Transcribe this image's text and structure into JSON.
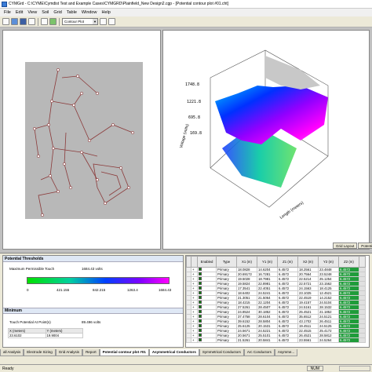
{
  "window": {
    "title": "CYMGrd - C:\\CYME\\Cymdist Test and Example Cases\\CYMGRD\\Plainfield_New Design2.cgp - [Potential contour plot #01.cht]"
  },
  "menu": [
    "File",
    "Edit",
    "View",
    "Soil",
    "Grid",
    "Table",
    "Window",
    "Help"
  ],
  "toolbar": {
    "view_select": "Contour Plot"
  },
  "chart3d": {
    "zticks": [
      "1748.8",
      "1221.8",
      "695.8",
      "169.8"
    ],
    "axis_x": "Length (meters)",
    "axis_z": "Voltage (volts)"
  },
  "right_tabs": [
    "Grid Layout",
    "Potential co..."
  ],
  "potential": {
    "header": "Potential Thresholds",
    "permissible_label": "Maximum Permissible Touch",
    "permissible_value": "1684.43 volts",
    "scale": [
      "0",
      "421.155",
      "842.215",
      "1263.4",
      "1684.43"
    ],
    "minimum_header": "Minimum",
    "touch_label": "Touch Potential At Point(s)",
    "touch_value": "89.496 volts",
    "col_x": "X (meters)",
    "col_y": "Y (meters)",
    "point": {
      "x": "23.6102",
      "y": "19.9004"
    }
  },
  "grid": {
    "headers": [
      "Enabled",
      "Type",
      "X1 (m)",
      "Y1 (m)",
      "Z1 (m)",
      "X2 (m)",
      "Y2 (m)",
      "Z2 (m)"
    ],
    "rows": [
      [
        "Primary",
        "18.0828",
        "14.6204",
        "6.4572",
        "18.2561",
        "23.4848",
        "6.4572"
      ],
      [
        "Primary",
        "20.69172",
        "16.7281",
        "6.4572",
        "20.7564",
        "23.5248",
        "6.4572"
      ],
      [
        "Primary",
        "19.5028",
        "18.7981",
        "6.4572",
        "22.5214",
        "25.1254",
        "6.4572"
      ],
      [
        "Primary",
        "19.5824",
        "22.8981",
        "6.4572",
        "22.5721",
        "23.1562",
        "6.4572"
      ],
      [
        "Primary",
        "17.3541",
        "22.4051",
        "6.4572",
        "24.1563",
        "18.4125",
        "6.4572"
      ],
      [
        "Primary",
        "18.6402",
        "24.5241",
        "6.4572",
        "23.1025",
        "12.4521",
        "6.4572"
      ],
      [
        "Primary",
        "21.3051",
        "21.5064",
        "6.4572",
        "22.4519",
        "14.2152",
        "6.4572"
      ],
      [
        "Primary",
        "18.4215",
        "22.1204",
        "6.4572",
        "19.4157",
        "24.5104",
        "6.4572"
      ],
      [
        "Primary",
        "27.5261",
        "28.4507",
        "6.4572",
        "24.5161",
        "28.1532",
        "6.4572"
      ],
      [
        "Primary",
        "24.8524",
        "30.1852",
        "6.4572",
        "25.4521",
        "21.1852",
        "6.4572"
      ],
      [
        "Primary",
        "37.4758",
        "28.6104",
        "6.4572",
        "35.6512",
        "24.5121",
        "6.4572"
      ],
      [
        "Primary",
        "39.6152",
        "28.5804",
        "6.4572",
        "43.1702",
        "26.4511",
        "6.4572"
      ],
      [
        "Primary",
        "25.6125",
        "20.1531",
        "6.4572",
        "19.4511",
        "24.5125",
        "6.4572"
      ],
      [
        "Primary",
        "24.5671",
        "24.5221",
        "6.4572",
        "22.4515",
        "25.4172",
        "6.4572"
      ],
      [
        "Primary",
        "20.5671",
        "25.5101",
        "6.4572",
        "26.4521",
        "28.5812",
        "6.4572"
      ],
      [
        "Primary",
        "21.5261",
        "20.5841",
        "6.4572",
        "23.5561",
        "24.5264",
        "6.4572"
      ]
    ]
  },
  "bottom_tabs": [
    "all Analysis",
    "Electrode Sizing",
    "Grid Analysis",
    "Report",
    "Potential contour plot #01",
    "Asymmetrical Conductors",
    "Symmetrical Conductors",
    "Arc Conductors",
    "Asymme..."
  ],
  "status": {
    "ready": "Ready",
    "num": "NUM"
  }
}
